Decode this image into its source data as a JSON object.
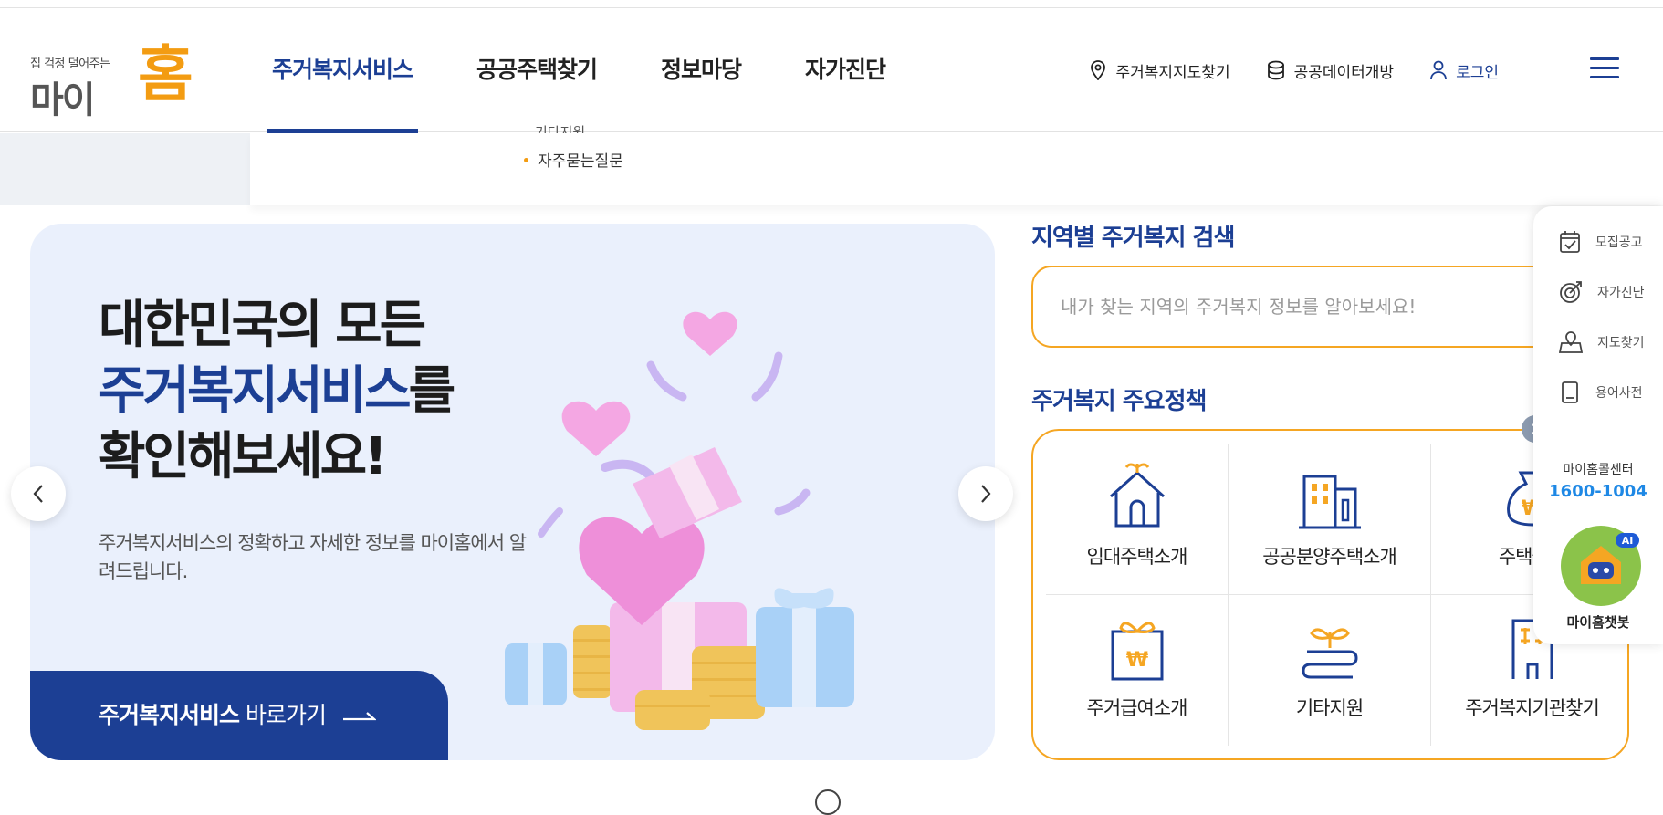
{
  "header": {
    "logo": {
      "tagline": "집 걱정 덜어주는",
      "name_part1": "마이",
      "name_part2": "홈"
    },
    "nav": [
      {
        "label": "주거복지서비스",
        "active": true
      },
      {
        "label": "공공주택찾기",
        "active": false
      },
      {
        "label": "정보마당",
        "active": false
      },
      {
        "label": "자가진단",
        "active": false
      }
    ],
    "utils": {
      "map": "주거복지지도찾기",
      "data": "공공데이터개방",
      "login": "로그인"
    },
    "menu_icon": "hamburger-icon"
  },
  "submenu": {
    "cut_item": "기타지원",
    "item": "자주묻는질문"
  },
  "banner": {
    "line1": "대한민국의 모든",
    "line2_blue": "주거복지서비스",
    "line2_rest": "를",
    "line3": "확인해보세요!",
    "description": "주거복지서비스의 정확하고 자세한 정보를 마이홈에서 알려드립니다.",
    "go_bold": "주거복지서비스",
    "go_rest": " 바로가기"
  },
  "region_search": {
    "title": "지역별 주거복지 검색",
    "placeholder": "내가 찾는 지역의 주거복지 정보를 알아보세요!"
  },
  "policy": {
    "title": "주거복지 주요정책",
    "items": [
      {
        "label": "임대주택소개",
        "icon": "house-icon"
      },
      {
        "label": "공공분양주택소개",
        "icon": "building-icon"
      },
      {
        "label": "주택금융",
        "icon": "money-bag-icon"
      },
      {
        "label": "주거급여소개",
        "icon": "gift-won-icon"
      },
      {
        "label": "기타지원",
        "icon": "sprout-icon"
      },
      {
        "label": "주거복지기관찾기",
        "icon": "office-icon"
      }
    ]
  },
  "quick_menu": {
    "items": [
      {
        "label": "모집공고",
        "icon": "calendar-check-icon"
      },
      {
        "label": "자가진단",
        "icon": "target-icon"
      },
      {
        "label": "지도찾기",
        "icon": "map-icon"
      },
      {
        "label": "용어사전",
        "icon": "book-icon"
      }
    ],
    "center_label": "마이홈콜센터",
    "center_number": "1600-1004",
    "chatbot_label": "마이홈챗봇",
    "chatbot_badge": "AI"
  },
  "colors": {
    "primary": "#1c3f94",
    "accent": "#f5a623",
    "banner_bg": "#eaf0fc"
  }
}
